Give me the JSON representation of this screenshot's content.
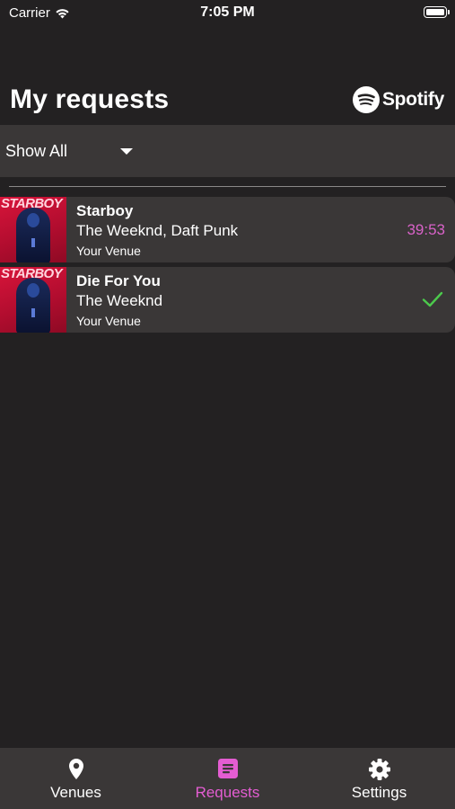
{
  "status_bar": {
    "carrier": "Carrier",
    "time": "7:05 PM"
  },
  "header": {
    "title": "My requests",
    "logo_text": "Spotify"
  },
  "filter": {
    "selected": "Show All"
  },
  "requests": [
    {
      "title": "Starboy",
      "artist": "The Weeknd, Daft Punk",
      "venue": "Your Venue",
      "status": "countdown",
      "countdown": "39:53",
      "album_art_text": "STARBOY"
    },
    {
      "title": "Die For You",
      "artist": "The Weeknd",
      "venue": "Your Venue",
      "status": "played",
      "album_art_text": "STARBOY"
    }
  ],
  "tab_bar": {
    "tabs": [
      {
        "label": "Venues",
        "icon": "map-pin-icon",
        "active": false
      },
      {
        "label": "Requests",
        "icon": "list-icon",
        "active": true
      },
      {
        "label": "Settings",
        "icon": "gear-icon",
        "active": false
      }
    ]
  },
  "colors": {
    "background": "#232122",
    "surface": "#3a3737",
    "accent": "#e45dd2",
    "countdown": "#d862c8",
    "success": "#4cc94c"
  }
}
